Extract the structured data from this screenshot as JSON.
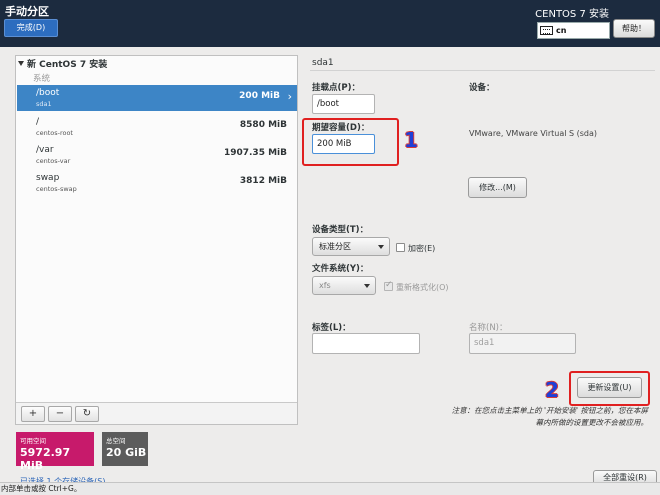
{
  "header": {
    "title": "手动分区",
    "done_label": "完成(D)",
    "product": "CENTOS 7 安装",
    "keyboard_layout": "cn",
    "help_label": "帮助！",
    "background_color": "#1c2b3f",
    "accent_color": "#2d6dbf"
  },
  "sidebar": {
    "install_label": "新 CentOS 7 安装",
    "section_label": "系统",
    "mounts": [
      {
        "name": "/boot",
        "device": "sda1",
        "size": "200 MiB",
        "selected": true
      },
      {
        "name": "/",
        "device": "centos-root",
        "size": "8580 MiB",
        "selected": false
      },
      {
        "name": "/var",
        "device": "centos-var",
        "size": "1907.35 MiB",
        "selected": false
      },
      {
        "name": "swap",
        "device": "centos-swap",
        "size": "3812 MiB",
        "selected": false
      }
    ],
    "tools": {
      "add": "+",
      "remove": "−",
      "refresh": "↻"
    }
  },
  "space": {
    "available_label": "可用空间",
    "available_value": "5972.97 MiB",
    "available_color": "#c71a6b",
    "total_label": "总空间",
    "total_value": "20 GiB",
    "total_color": "#5c5c5c",
    "storage_link": "已选择 1 个存储设备(S)"
  },
  "detail": {
    "partition_title": "sda1",
    "mount_point_label": "挂载点(P)：",
    "mount_point_value": "/boot",
    "desired_capacity_label": "期望容量(D)：",
    "desired_capacity_value": "200 MiB",
    "device_label": "设备：",
    "device_value": "VMware, VMware Virtual S (sda)",
    "modify_label": "修改...(M)",
    "device_type_label": "设备类型(T)：",
    "device_type_value": "标准分区",
    "encrypt_label": "加密(E)",
    "encrypt_checked": false,
    "filesystem_label": "文件系统(Y)：",
    "filesystem_value": "xfs",
    "reformat_label": "重新格式化(O)",
    "reformat_checked": true,
    "tag_label": "标签(L)：",
    "tag_value": "",
    "name_label": "名称(N)：",
    "name_value": "sda1",
    "update_label": "更新设置(U)",
    "note": "注意：在您点击主菜单上的 '开始安装' 按钮之前，您在本屏幕内所做的设置更改不会被应用。",
    "reset_label": "全部重设(R)"
  },
  "annotations": {
    "first": "1",
    "second": "2",
    "color": "#e02020"
  },
  "status_bar": "内部单击或按 Ctrl+G。"
}
